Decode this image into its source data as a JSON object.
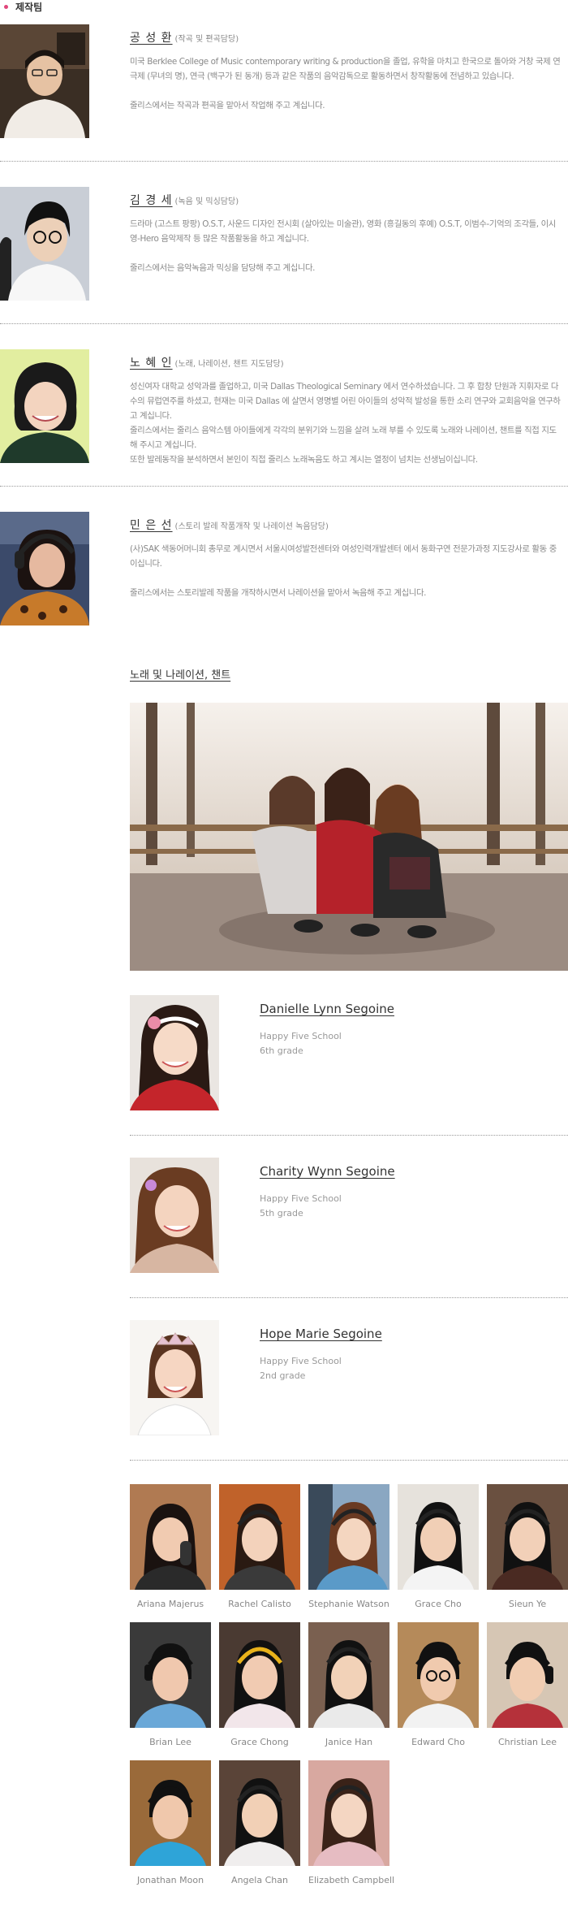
{
  "section_title": "제작팀",
  "staff": [
    {
      "name": "공 성 환",
      "role": "(작곡 및 편곡담당)",
      "bio": "미국 Berklee College of Music contemporary writing & production을 졸업, 유학을 마치고 한국으로 돌아와 거창 국제 연극제 (무녀의 명), 연극 (백구가 된 동개) 등과 같은 작품의 음악감독으로 활동하면서 창작활동에 전념하고 있습니다.",
      "note": "줄리스에서는 작곡과 편곡을 맡아서 작업해 주고 계십니다."
    },
    {
      "name": "김 경 세",
      "role": "(녹음 및 믹싱담당)",
      "bio": "드라마 (고스트 팡팡) O.S.T, 사운드 디자인 전시회 (살아있는 미술관), 영화 (흥길동의 후예) O.S.T, 이범수-기억의 조각들, 이시영-Hero 음악제작 등 많은 작품활동을 하고 계십니다.",
      "note": "줄리스에서는 음악녹음과 믹싱을 담당해 주고 계십니다."
    },
    {
      "name": "노 혜 인",
      "role": "(노래, 나레이션, 챈트 지도담당)",
      "bio": "성신여자 대학교 성악과를 졸업하고, 미국  Dallas Theological Seminary 에서 연수하셨습니다. 그 후 합창 단원과 지휘자로 다수의 뮤럽연주를 하셨고, 현재는 미국 Dallas 에 살면서 영명별 어린 아이들의 성악적 발성을 통한 소리 연구와 교회음악을 연구하고 계십니다.",
      "note": "줄리스에서는 줄리스 음악스템 아이들에게 각각의 분위기와 느낌을 살려 노래 부를 수 있도록 노래와 나레이션, 챈트를 직접 지도해 주시고 계십니다.",
      "note2": "또한 발레동작을 분석하면서 본인이 직접 줄리스 노래녹음도 하고 계시는 열정이 넘치는 선생님이십니다."
    },
    {
      "name": "민 은 선",
      "role": "(스토리 발레 작품개작 및 나레이션 녹음담당)",
      "bio": "(사)SAK 색동어머니회 총무로 계시면서 서울시여성발전센터와 여성인력개발센터 에서 동화구연 전문가과정 지도강사로 활동 중 이십니다.",
      "note": "줄리스에서는 스토리발레 작품을 개작하시면서 나레이션을 맡아서 녹음해 주고 계십니다."
    }
  ],
  "singers_heading": "노래 및 나레이션, 챈트",
  "featured": [
    {
      "name": "Danielle Lynn Segoine",
      "school": "Happy Five School",
      "grade": "6th grade"
    },
    {
      "name": "Charity Wynn Segoine",
      "school": "Happy Five School",
      "grade": "5th grade"
    },
    {
      "name": "Hope Marie Segoine",
      "school": "Happy Five School",
      "grade": "2nd grade"
    }
  ],
  "kids": [
    "Ariana Majerus",
    "Rachel Calisto",
    "Stephanie Watson",
    "Grace Cho",
    "Sieun Ye",
    "Brian Lee",
    "Grace Chong",
    "Janice Han",
    "Edward Cho",
    "Christian Lee",
    "Jonathan Moon",
    "Angela Chan",
    "Elizabeth Campbell"
  ],
  "colors": {
    "accent_dot": "#e0457b",
    "name_text": "#333333",
    "body_text": "#8a8a8a"
  }
}
